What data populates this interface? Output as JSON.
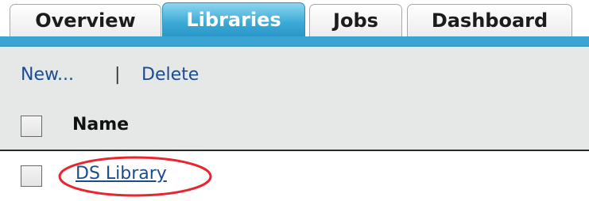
{
  "tabs": [
    {
      "label": "Overview",
      "active": false
    },
    {
      "label": "Libraries",
      "active": true
    },
    {
      "label": "Jobs",
      "active": false
    },
    {
      "label": "Dashboard",
      "active": false
    }
  ],
  "actions": {
    "new_label": "New...",
    "separator": "|",
    "delete_label": "Delete"
  },
  "table": {
    "columns": [
      "Name"
    ],
    "rows": [
      {
        "name": "DS Library",
        "checked": false,
        "highlighted": true
      }
    ]
  },
  "colors": {
    "accent": "#3aa5d2",
    "link": "#1a4d8f",
    "highlight": "#e8262f",
    "panel_bg": "#e6e8e8"
  }
}
